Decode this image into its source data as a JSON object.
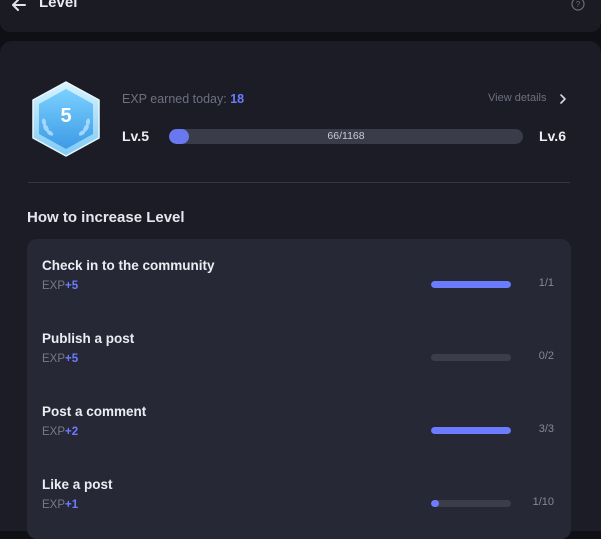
{
  "header": {
    "title": "Level"
  },
  "level": {
    "badge_number": "5",
    "exp_today_label": "EXP earned today:",
    "exp_today_value": "18",
    "view_details": "View details",
    "current_level": "Lv.5",
    "next_level": "Lv.6",
    "progress_text": "66/1168",
    "progress_fraction": 0.0565
  },
  "section": {
    "title": "How to increase Level"
  },
  "tasks": [
    {
      "name": "Check in to the community",
      "exp_label": "EXP",
      "exp_points": "+5",
      "count": "1/1",
      "fraction": 1.0
    },
    {
      "name": "Publish a post",
      "exp_label": "EXP",
      "exp_points": "+5",
      "count": "0/2",
      "fraction": 0.0
    },
    {
      "name": "Post a comment",
      "exp_label": "EXP",
      "exp_points": "+2",
      "count": "3/3",
      "fraction": 1.0
    },
    {
      "name": "Like a post",
      "exp_label": "EXP",
      "exp_points": "+1",
      "count": "1/10",
      "fraction": 0.1
    }
  ],
  "colors": {
    "accent": "#6b7cff",
    "panel": "#1b1c25",
    "card": "#262836",
    "badge_light": "#b9e8ff",
    "badge_dark": "#3fa6ee"
  },
  "icons": [
    "back-arrow-icon",
    "help-icon",
    "chevron-right-icon",
    "level-badge-icon",
    "laurel-icon"
  ]
}
